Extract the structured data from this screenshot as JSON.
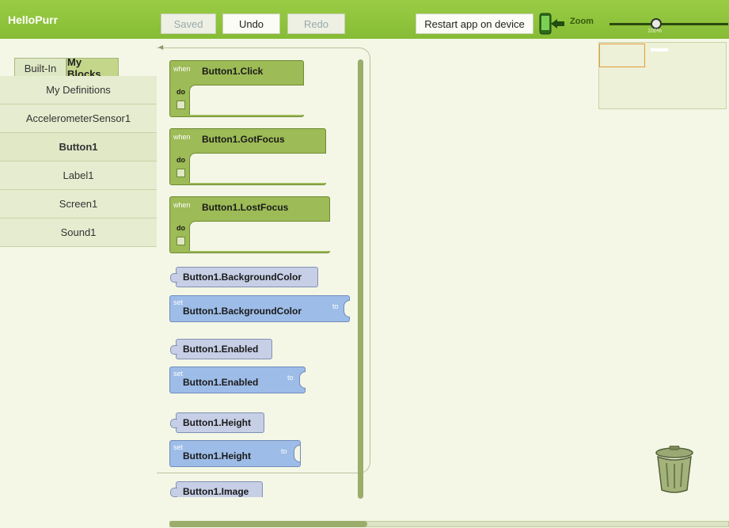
{
  "app": {
    "title": "HelloPurr"
  },
  "toolbar": {
    "saved_label": "Saved",
    "undo_label": "Undo",
    "redo_label": "Redo",
    "restart_label": "Restart app on device",
    "zoom_label": "Zoom",
    "zoom_value": "100%",
    "zoom_level_percent": 100
  },
  "palette": {
    "tabs": [
      {
        "label": "Built-In",
        "active": false
      },
      {
        "label": "My Blocks",
        "active": true
      }
    ],
    "items": [
      {
        "label": "My Definitions",
        "selected": false
      },
      {
        "label": "AccelerometerSensor1",
        "selected": false
      },
      {
        "label": "Button1",
        "selected": true
      },
      {
        "label": "Label1",
        "selected": false
      },
      {
        "label": "Screen1",
        "selected": false
      },
      {
        "label": "Sound1",
        "selected": false
      }
    ]
  },
  "blocks": {
    "event_keyword": "when",
    "do_keyword": "do",
    "set_keyword": "set",
    "to_keyword": "to",
    "events": [
      "Button1.Click",
      "Button1.GotFocus",
      "Button1.LostFocus"
    ],
    "getter_background": "Button1.BackgroundColor",
    "setter_background": "Button1.BackgroundColor",
    "getter_enabled": "Button1.Enabled",
    "setter_enabled": "Button1.Enabled",
    "getter_height": "Button1.Height",
    "setter_height": "Button1.Height",
    "getter_image": "Button1.Image"
  },
  "colors": {
    "topbar": "#8fc33e",
    "event_block": "#9dbb56",
    "setter_block": "#9dbce7",
    "getter_block": "#c7cfe6",
    "background": "#f4f7e6"
  },
  "icons": [
    "phone-arrow-icon",
    "trash-can-icon",
    "zoom-slider-knob"
  ]
}
